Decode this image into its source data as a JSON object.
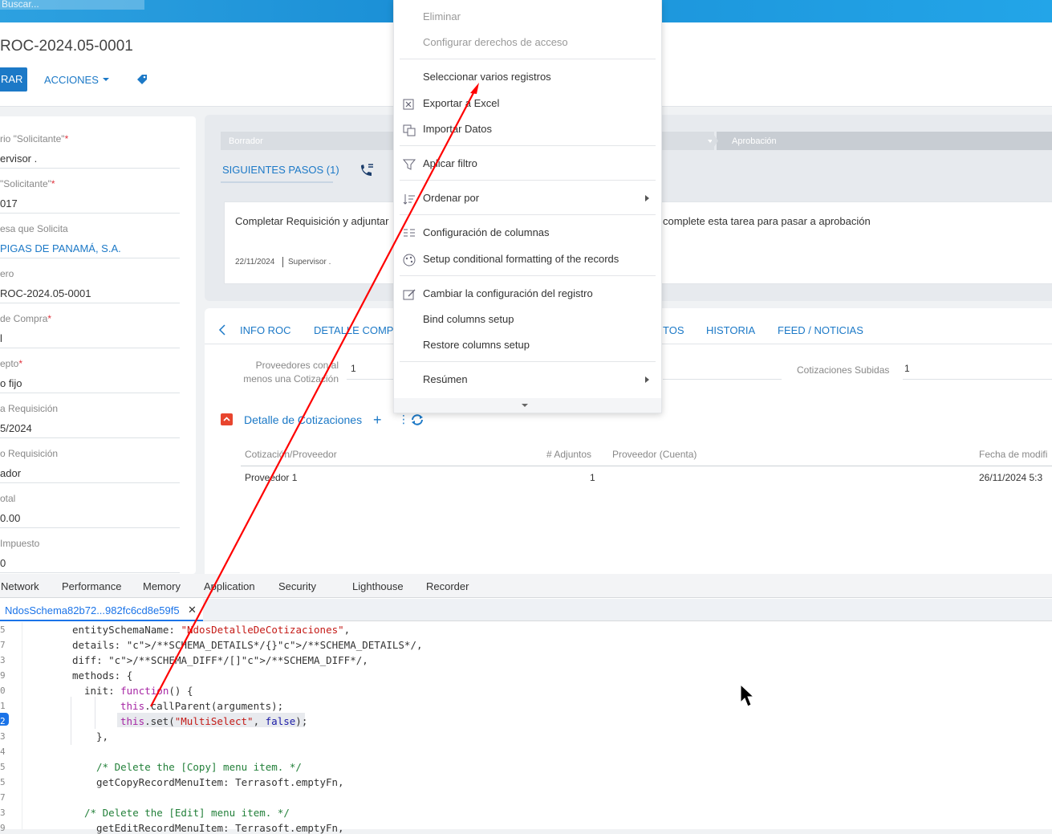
{
  "topbar": {
    "search_placeholder": "Buscar..."
  },
  "header": {
    "record_title": "ROC-2024.05-0001",
    "save_label": "RAR",
    "actions_label": "ACCIONES"
  },
  "left_fields": [
    {
      "label": "rio \"Solicitante\"",
      "value": "ervisor .",
      "required": true
    },
    {
      "label": "\"Solicitante\"",
      "value": "017",
      "required": true
    },
    {
      "label": "esa que Solicita",
      "value": "PIGAS DE PANAMÁ, S.A."
    },
    {
      "label": "ero",
      "value": "ROC-2024.05-0001"
    },
    {
      "label": "de Compra",
      "value": "l",
      "required": true
    },
    {
      "label": "epto",
      "value": "o fijo",
      "required": true
    },
    {
      "label": "a Requisición",
      "value": "5/2024"
    },
    {
      "label": "o Requisición",
      "value": "ador"
    },
    {
      "label": "otal",
      "value": "0.00"
    },
    {
      "label": "Impuesto",
      "value": "0"
    }
  ],
  "stages": {
    "draft": "Borrador",
    "approval": "Aprobación"
  },
  "next_steps": {
    "tab_label": "SIGUIENTES PASOS (1)"
  },
  "task": {
    "text_left": "Completar Requisición y adjuntar",
    "text_right": "complete esta tarea para pasar a aprobación",
    "date": "22/11/2024",
    "user": "Supervisor ."
  },
  "tabs": [
    "INFO ROC",
    "DETALLE COMPR",
    "TOS",
    "HISTORIA",
    "FEED / NOTICIAS"
  ],
  "summary": {
    "prov_label": "Proveedores con al menos una Cotización",
    "prov_value": "1",
    "cot_subidas_label": "Cotizaciones Subidas",
    "cot_subidas_value": "1"
  },
  "detail": {
    "title": "Detalle de Cotizaciones",
    "add": "+",
    "kebab": "⋮",
    "columns": [
      "Cotización/Proveedor",
      "# Adjuntos",
      "Proveedor (Cuenta)",
      "Fecha de modifi"
    ],
    "rows": [
      {
        "name": "Proveedor 1",
        "adjuntos": "1",
        "cuenta": "",
        "fecha": "26/11/2024 5:3"
      }
    ]
  },
  "menu": {
    "items": [
      {
        "label": "Eliminar",
        "disabled": true
      },
      {
        "label": "Configurar derechos de acceso",
        "disabled": true
      },
      {
        "label": "Seleccionar varios registros"
      },
      {
        "label": "Exportar a Excel",
        "icon": "excel-export-icon"
      },
      {
        "label": "Importar Datos",
        "icon": "import-data-icon"
      },
      {
        "label": "Aplicar filtro",
        "icon": "filter-icon"
      },
      {
        "label": "Ordenar por",
        "icon": "sort-icon",
        "submenu": true
      },
      {
        "label": "Configuración de columnas",
        "icon": "columns-icon"
      },
      {
        "label": "Setup conditional formatting of the records",
        "icon": "palette-icon"
      },
      {
        "label": "Cambiar la configuración del registro",
        "icon": "edit-record-icon"
      },
      {
        "label": "Bind columns setup"
      },
      {
        "label": "Restore columns setup"
      },
      {
        "label": "Resúmen",
        "submenu": true
      }
    ]
  },
  "devtools": {
    "tabs": [
      "Network",
      "Performance",
      "Memory",
      "Application",
      "Security",
      "Lighthouse",
      "Recorder"
    ],
    "file_name": "NdosSchema82b72...982fc6cd8e59f5",
    "close": "✕",
    "line_numbers": [
      "5",
      "7",
      "3",
      "9",
      "0",
      "1",
      "2",
      "3",
      "4",
      "5",
      "5",
      "7",
      "3",
      "9"
    ],
    "code_lines": [
      "entitySchemaName: \"NdosDetalleDeCotizaciones\",",
      "details: /**SCHEMA_DETAILS*/{}/**SCHEMA_DETAILS*/,",
      "diff: /**SCHEMA_DIFF*/[]/**SCHEMA_DIFF*/,",
      "methods: {",
      "init: function() {",
      "this.callParent(arguments);",
      "this.set(\"MultiSelect\", false);",
      "},",
      "",
      "/* Delete the [Copy] menu item. */",
      "getCopyRecordMenuItem: Terrasoft.emptyFn,",
      "",
      "/* Delete the [Edit] menu item. */",
      "getEditRecordMenuItem: Terrasoft.emptyFn,"
    ]
  },
  "colors": {
    "accent": "#1c79c7",
    "topbar": "#23a5e8",
    "annotation_arrow": "#ff0000",
    "collapse": "#e8452e"
  }
}
